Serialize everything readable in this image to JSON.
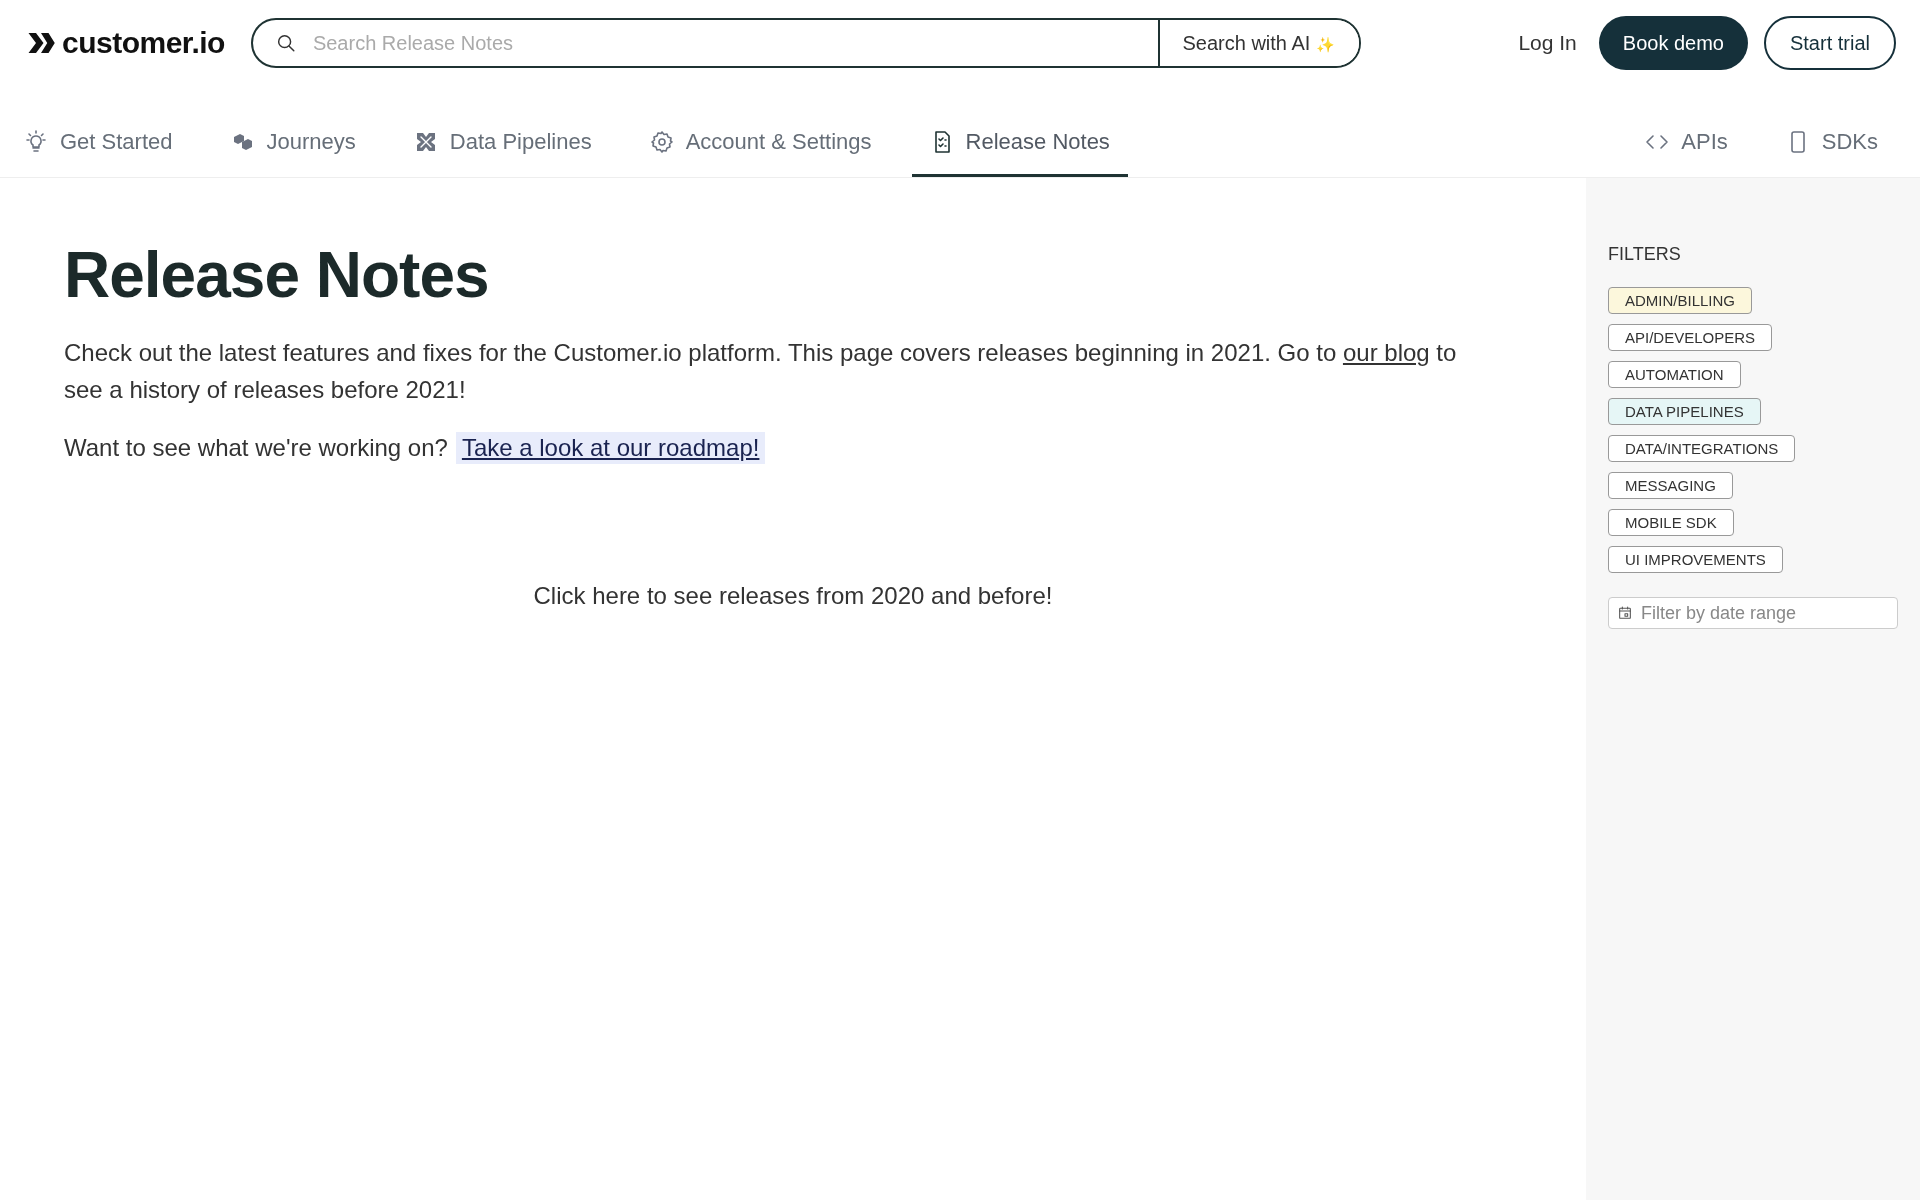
{
  "header": {
    "logo": "customer.io",
    "search": {
      "placeholder": "Search Release Notes"
    },
    "ai_button": "Search with AI",
    "ai_sparkle": "✨",
    "login": "Log In",
    "book_demo": "Book demo",
    "start_trial": "Start trial"
  },
  "nav": {
    "left": [
      {
        "label": "Get Started",
        "selected": false
      },
      {
        "label": "Journeys",
        "selected": false
      },
      {
        "label": "Data Pipelines",
        "selected": false
      },
      {
        "label": "Account & Settings",
        "selected": false
      },
      {
        "label": "Release Notes",
        "selected": true
      }
    ],
    "right": [
      {
        "label": "APIs",
        "selected": false
      },
      {
        "label": "SDKs",
        "selected": false
      }
    ]
  },
  "main": {
    "title": "Release Notes",
    "intro": {
      "before": "Check out the latest features and fixes for the Customer.io platform. This page covers releases beginning in 2021. Go to ",
      "link": "our blog",
      "after": " to see a history of releases before 2021!"
    },
    "roadmap": {
      "text": "Want to see what we're working on?",
      "link": "Take a look at our roadmap!"
    },
    "older_link": "Click here to see releases from 2020 and before!"
  },
  "filters": {
    "heading": "FILTERS",
    "tags": [
      {
        "label": "ADMIN/BILLING",
        "color": "#fcf7dc"
      },
      {
        "label": "API/DEVELOPERS",
        "color": "#ffffff"
      },
      {
        "label": "AUTOMATION",
        "color": "#ffffff"
      },
      {
        "label": "DATA PIPELINES",
        "color": "#e6f6f6"
      },
      {
        "label": "DATA/INTEGRATIONS",
        "color": "#ffffff"
      },
      {
        "label": "MESSAGING",
        "color": "#ffffff"
      },
      {
        "label": "MOBILE SDK",
        "color": "#ffffff"
      },
      {
        "label": "UI IMPROVEMENTS",
        "color": "#ffffff"
      }
    ],
    "date": {
      "placeholder": "Filter by date range"
    }
  }
}
